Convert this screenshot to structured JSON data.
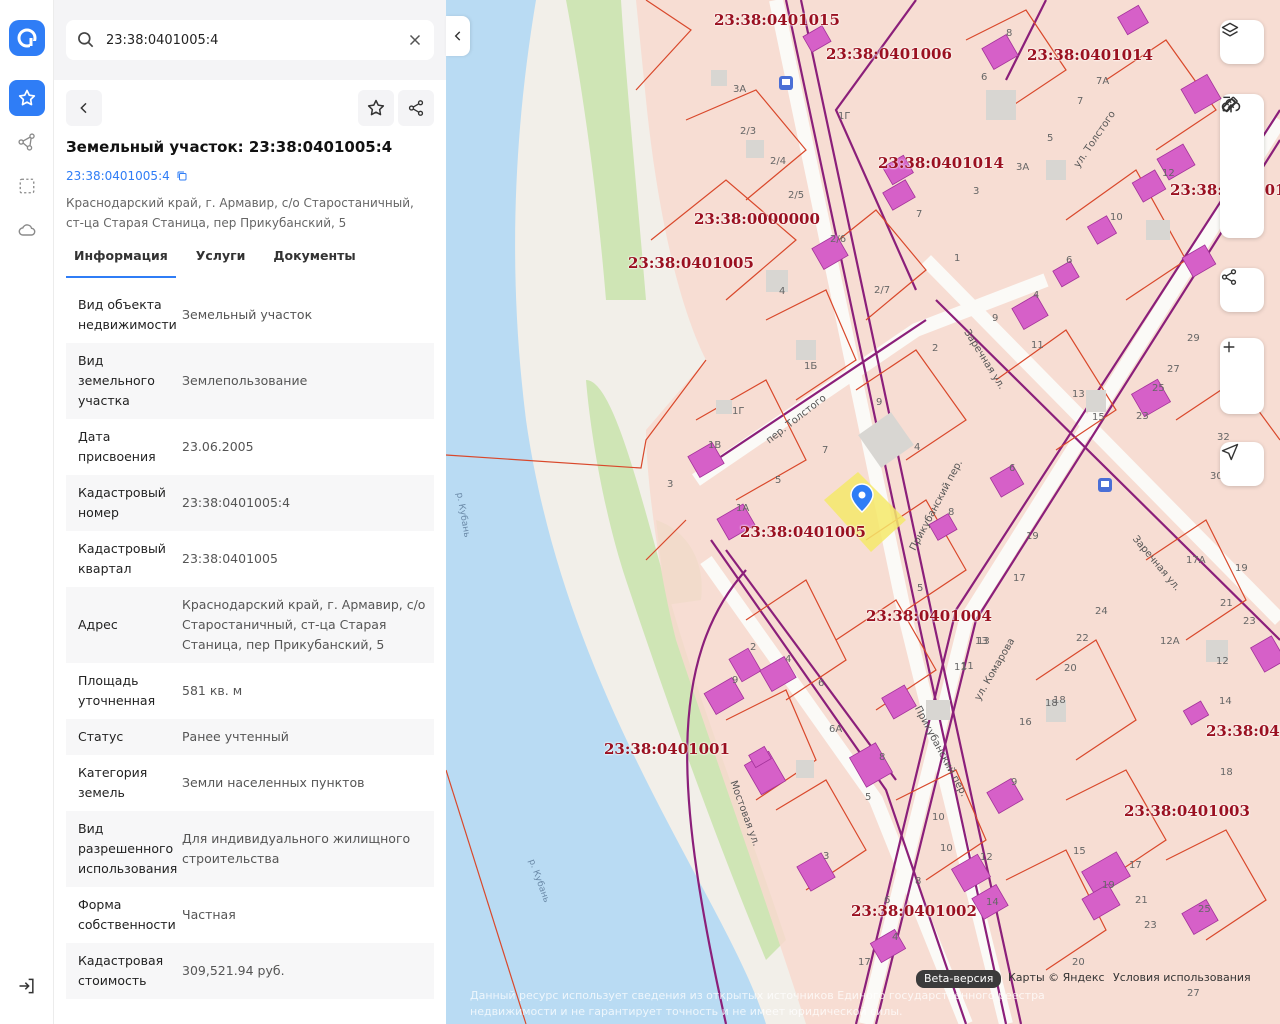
{
  "search": {
    "value": "23:38:0401005:4"
  },
  "card": {
    "title": "Земельный участок: 23:38:0401005:4",
    "cad_link": "23:38:0401005:4",
    "address": "Краснодарский край, г. Армавир, с/о Старостаничный, ст-ца Старая Станица, пер Прикубанский, 5",
    "tabs": [
      "Информация",
      "Услуги",
      "Документы"
    ],
    "rows": [
      {
        "k": "Вид объекта недвижимости",
        "v": "Земельный участок"
      },
      {
        "k": "Вид земельного участка",
        "v": "Землепользование"
      },
      {
        "k": "Дата присвоения",
        "v": "23.06.2005"
      },
      {
        "k": "Кадастровый номер",
        "v": "23:38:0401005:4"
      },
      {
        "k": "Кадастровый квартал",
        "v": "23:38:0401005"
      },
      {
        "k": "Адрес",
        "v": "Краснодарский край, г. Армавир, с/о Старостаничный, ст-ца Старая Станица, пер Прикубанский, 5"
      },
      {
        "k": "Площадь уточненная",
        "v": "581 кв. м"
      },
      {
        "k": "Статус",
        "v": "Ранее учтенный"
      },
      {
        "k": "Категория земель",
        "v": "Земли населенных пунктов"
      },
      {
        "k": "Вид разрешенного использования",
        "v": "Для индивидуального жилищного строительства"
      },
      {
        "k": "Форма собственности",
        "v": "Частная"
      },
      {
        "k": "Кадастровая стоимость",
        "v": "309,521.94 руб."
      }
    ]
  },
  "map": {
    "quarters": [
      "23:38:0401015",
      "23:38:0401006",
      "23:38:0401014",
      "23:38:0401014",
      "23:38:040101",
      "23:38:0000000",
      "23:38:0401005",
      "23:38:0401005",
      "23:38:0401004",
      "23:38:0401001",
      "23:38:0401003",
      "23:38:040",
      "23:38:0401002"
    ],
    "river_name": "р. Кубань",
    "streets": {
      "tolstogo": "пер. Толстого",
      "zarechnaya": "Заречная ул.",
      "prikubansky": "Прикубанский пер.",
      "komarova": "ул. Комарова",
      "mostovaya": "Мостовая ул.",
      "lenina": "ул. Толстого"
    },
    "house_numbers": [
      "3А",
      "1Г",
      "2/3",
      "2/4",
      "2/5",
      "2/6",
      "2/7",
      "4",
      "1Б",
      "1Г",
      "1В",
      "3",
      "1А",
      "5",
      "2",
      "9",
      "7",
      "4",
      "5",
      "8",
      "6",
      "19",
      "17",
      "1",
      "3",
      "7",
      "8",
      "6",
      "3А",
      "5",
      "7А",
      "7",
      "10",
      "12",
      "6",
      "4",
      "9",
      "11",
      "13",
      "15",
      "23",
      "25",
      "27",
      "29",
      "32",
      "30А",
      "17А",
      "19",
      "21",
      "23",
      "12",
      "14",
      "18",
      "22",
      "24",
      "12А",
      "20",
      "16",
      "18",
      "13",
      "11",
      "9",
      "15",
      "17",
      "19",
      "21",
      "23",
      "25",
      "20",
      "27",
      "10",
      "10",
      "8",
      "12",
      "14",
      "6",
      "4",
      "17",
      "18",
      "2",
      "4",
      "6",
      "9",
      "6А",
      "8",
      "5",
      "3",
      "11",
      "13"
    ],
    "beta": "Beta-версия",
    "copyright": "Карты © Яндекс",
    "terms": "Условия использования",
    "disclaimer": "Данный ресурс использует сведения из открытых источников Единого государственного реестра недвижимости и не гарантирует точность и не имеет юридической силы."
  },
  "colors": {
    "accent": "#2f7df6",
    "parcel_border": "#d9482b",
    "quarter_border": "#8b1f7a",
    "label": "#9a1020",
    "water": "#b9dbf3",
    "green": "#cfe5b5",
    "highlight": "#f5e96a"
  }
}
